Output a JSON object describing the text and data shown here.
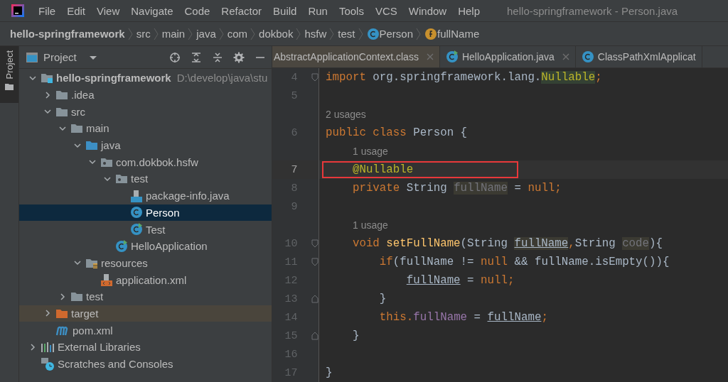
{
  "menu": [
    "File",
    "Edit",
    "View",
    "Navigate",
    "Code",
    "Refactor",
    "Build",
    "Run",
    "Tools",
    "VCS",
    "Window",
    "Help"
  ],
  "window": {
    "title": "hello-springframework - Person.java"
  },
  "breadcrumbs": [
    {
      "label": "hello-springframework",
      "kind": "project"
    },
    {
      "label": "src",
      "kind": "folder"
    },
    {
      "label": "main",
      "kind": "folder"
    },
    {
      "label": "java",
      "kind": "folder"
    },
    {
      "label": "com",
      "kind": "folder"
    },
    {
      "label": "dokbok",
      "kind": "folder"
    },
    {
      "label": "hsfw",
      "kind": "folder"
    },
    {
      "label": "test",
      "kind": "folder"
    },
    {
      "label": "Person",
      "kind": "class"
    },
    {
      "label": "fullName",
      "kind": "field"
    }
  ],
  "side_strip": {
    "label": "Project"
  },
  "project_panel": {
    "title": "Project"
  },
  "tree": [
    {
      "name": "hello-springframework",
      "location": "D:\\develop\\java\\stu",
      "kind": "module",
      "expanded": true,
      "selected": false,
      "excluded": false,
      "children": [
        {
          "name": ".idea",
          "kind": "folder",
          "expanded": false,
          "selected": false,
          "excluded": false
        },
        {
          "name": "src",
          "kind": "folder",
          "expanded": true,
          "selected": false,
          "excluded": false,
          "children": [
            {
              "name": "main",
              "kind": "folder",
              "expanded": true,
              "selected": false,
              "excluded": false,
              "children": [
                {
                  "name": "java",
                  "kind": "source",
                  "expanded": true,
                  "selected": false,
                  "excluded": false,
                  "children": [
                    {
                      "name": "com.dokbok.hsfw",
                      "kind": "package",
                      "expanded": true,
                      "selected": false,
                      "excluded": false,
                      "children": [
                        {
                          "name": "test",
                          "kind": "package",
                          "expanded": true,
                          "selected": false,
                          "excluded": false,
                          "children": [
                            {
                              "name": "package-info.java",
                              "kind": "javafile",
                              "selected": false,
                              "excluded": false
                            },
                            {
                              "name": "Person",
                              "kind": "class",
                              "selected": true,
                              "excluded": false
                            },
                            {
                              "name": "Test",
                              "kind": "runclass",
                              "selected": false,
                              "excluded": false
                            }
                          ]
                        },
                        {
                          "name": "HelloApplication",
                          "kind": "runclass",
                          "selected": false,
                          "excluded": false
                        }
                      ]
                    }
                  ]
                },
                {
                  "name": "resources",
                  "kind": "resources",
                  "expanded": true,
                  "selected": false,
                  "excluded": false,
                  "children": [
                    {
                      "name": "application.xml",
                      "kind": "xml",
                      "selected": false,
                      "excluded": false
                    }
                  ]
                }
              ]
            },
            {
              "name": "test",
              "kind": "folder",
              "expanded": false,
              "selected": false,
              "excluded": false
            }
          ]
        },
        {
          "name": "target",
          "kind": "folder",
          "expanded": false,
          "selected": false,
          "excluded": true
        },
        {
          "name": "pom.xml",
          "kind": "maven",
          "selected": false,
          "excluded": false
        }
      ]
    },
    {
      "name": "External Libraries",
      "kind": "libraries",
      "expanded": false,
      "selected": false,
      "excluded": false
    },
    {
      "name": "Scratches and Consoles",
      "kind": "scratches",
      "selected": false,
      "excluded": false
    }
  ],
  "tabs": [
    {
      "label": "AbstractApplicationContext.class",
      "kind": "file",
      "closable": true,
      "selected": false
    },
    {
      "label": "HelloApplication.java",
      "kind": "runclass",
      "closable": true,
      "selected": false
    },
    {
      "label": "ClassPathXmlApplicat",
      "kind": "class",
      "closable": false,
      "selected": false
    }
  ],
  "code": [
    {
      "kind": "code",
      "number": "4",
      "fold_start": true,
      "fold_end": false,
      "current": false,
      "boxed": false,
      "tokens": [
        {
          "text": "import ",
          "kind": "keyword"
        },
        {
          "text": "org.springframework.lang.",
          "kind": "plain"
        },
        {
          "text": "Nullable",
          "kind": "marked"
        },
        {
          "text": ";",
          "kind": "keyword"
        }
      ]
    },
    {
      "kind": "code",
      "number": "5",
      "fold_start": false,
      "fold_end": false,
      "current": false,
      "boxed": false
    },
    {
      "kind": "hint",
      "text": "2 usages"
    },
    {
      "kind": "code",
      "number": "6",
      "fold_start": false,
      "fold_end": false,
      "current": false,
      "boxed": false,
      "tokens": [
        {
          "text": "public class ",
          "kind": "keyword"
        },
        {
          "text": "Person {",
          "kind": "plain"
        }
      ]
    },
    {
      "kind": "hint",
      "text": "1 usage"
    },
    {
      "kind": "code",
      "number": "7",
      "fold_start": false,
      "fold_end": false,
      "current": true,
      "boxed": true,
      "tokens": [
        {
          "text": "    @Nullable",
          "kind": "annotation"
        }
      ]
    },
    {
      "kind": "code",
      "number": "8",
      "fold_start": false,
      "fold_end": false,
      "current": false,
      "boxed": false,
      "tokens": [
        {
          "text": "    private ",
          "kind": "keyword"
        },
        {
          "text": "String ",
          "kind": "plain"
        },
        {
          "text": "fullName",
          "kind": "unused"
        },
        {
          "text": " = ",
          "kind": "plain"
        },
        {
          "text": "null;",
          "kind": "keyword"
        }
      ]
    },
    {
      "kind": "code",
      "number": "9",
      "fold_start": false,
      "fold_end": false,
      "current": false,
      "boxed": false
    },
    {
      "kind": "hint",
      "text": "1 usage"
    },
    {
      "kind": "code",
      "number": "10",
      "fold_start": true,
      "fold_end": false,
      "current": false,
      "boxed": false,
      "tokens": [
        {
          "text": "    void ",
          "kind": "keyword"
        },
        {
          "text": "setFullName",
          "kind": "method"
        },
        {
          "text": "(String ",
          "kind": "plain"
        },
        {
          "text": "fullName",
          "kind": "parameter"
        },
        {
          "text": ",",
          "kind": "keyword"
        },
        {
          "text": "String ",
          "kind": "plain"
        },
        {
          "text": "code",
          "kind": "unused"
        },
        {
          "text": "){",
          "kind": "plain"
        }
      ]
    },
    {
      "kind": "code",
      "number": "11",
      "fold_start": true,
      "fold_end": false,
      "current": false,
      "boxed": false,
      "tokens": [
        {
          "text": "        if",
          "kind": "keyword"
        },
        {
          "text": "(fullName != ",
          "kind": "plain"
        },
        {
          "text": "null ",
          "kind": "keyword"
        },
        {
          "text": "&& fullName.isEmpty()){",
          "kind": "plain"
        }
      ]
    },
    {
      "kind": "code",
      "number": "12",
      "fold_start": false,
      "fold_end": false,
      "current": false,
      "boxed": false,
      "tokens": [
        {
          "text": "            fullName",
          "kind": "reference"
        },
        {
          "text": " = ",
          "kind": "plain"
        },
        {
          "text": "null;",
          "kind": "keyword"
        }
      ]
    },
    {
      "kind": "code",
      "number": "13",
      "fold_start": false,
      "fold_end": true,
      "current": false,
      "boxed": false,
      "tokens": [
        {
          "text": "        }",
          "kind": "plain"
        }
      ]
    },
    {
      "kind": "code",
      "number": "14",
      "fold_start": false,
      "fold_end": false,
      "current": false,
      "boxed": false,
      "tokens": [
        {
          "text": "        this.",
          "kind": "keyword"
        },
        {
          "text": "fullName",
          "kind": "field"
        },
        {
          "text": " = ",
          "kind": "plain"
        },
        {
          "text": "fullName",
          "kind": "reference"
        },
        {
          "text": ";",
          "kind": "keyword"
        }
      ]
    },
    {
      "kind": "code",
      "number": "15",
      "fold_start": false,
      "fold_end": true,
      "current": false,
      "boxed": false,
      "tokens": [
        {
          "text": "    }",
          "kind": "plain"
        }
      ]
    },
    {
      "kind": "code",
      "number": "16",
      "fold_start": false,
      "fold_end": false,
      "current": false,
      "boxed": false
    },
    {
      "kind": "code",
      "number": "17",
      "fold_start": false,
      "fold_end": false,
      "current": false,
      "boxed": false,
      "tokens": [
        {
          "text": "}",
          "kind": "plain"
        }
      ]
    }
  ]
}
